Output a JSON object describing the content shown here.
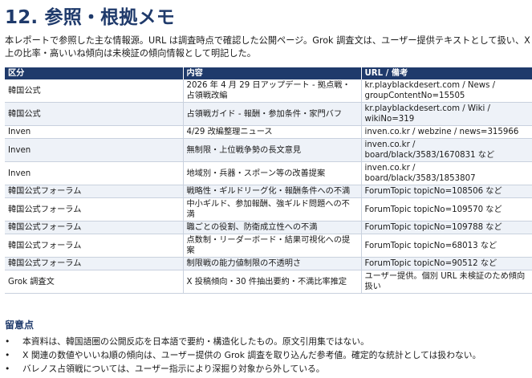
{
  "title": "12. 参照・根拠メモ",
  "intro": {
    "line1": "本レポートで参照した主な情報源。URL は調査時点で確認した公開ページ。Grok 調査文は、ユーザー提供テキストとして扱い、X",
    "line2": "上の比率・高いいね傾向は未検証の傾向情報として明記した。"
  },
  "table": {
    "headers": [
      "区分",
      "内容",
      "URL / 備考"
    ],
    "rows": [
      {
        "category": "韓国公式",
        "content": "2026 年 4 月 29 日アップデート - 拠点戦・占領戦改編",
        "url": "kr.playblackdesert.com / News / groupContentNo=15505"
      },
      {
        "category": "韓国公式",
        "content": "占領戦ガイド - 報酬・参加条件・家門バフ",
        "url": "kr.playblackdesert.com / Wiki / wikiNo=319"
      },
      {
        "category": "Inven",
        "content": "4/29 改編整理ニュース",
        "url": "inven.co.kr / webzine / news=315966"
      },
      {
        "category": "Inven",
        "content": "無制限・上位戦争勢の長文意見",
        "url": "inven.co.kr / board/black/3583/1670831 など"
      },
      {
        "category": "Inven",
        "content": "地域別・兵器・スポーン等の改善提案",
        "url": "inven.co.kr / board/black/3583/1853807"
      },
      {
        "category": "韓国公式フォーラム",
        "content": "戦略性・ギルドリーグ化・報酬条件への不満",
        "url": "ForumTopic topicNo=108506 など"
      },
      {
        "category": "韓国公式フォーラム",
        "content": "中小ギルド、参加報酬、強ギルド問題への不満",
        "url": "ForumTopic topicNo=109570 など"
      },
      {
        "category": "韓国公式フォーラム",
        "content": "職ごとの役割、防衛成立性への不満",
        "url": "ForumTopic topicNo=109788 など"
      },
      {
        "category": "韓国公式フォーラム",
        "content": "点数制・リーダーボード・結果可視化への提案",
        "url": "ForumTopic topicNo=68013 など"
      },
      {
        "category": "韓国公式フォーラム",
        "content": "制限戦の能力値制限の不透明さ",
        "url": "ForumTopic topicNo=90512 など"
      },
      {
        "category": "Grok 調査文",
        "content": "X 投稿傾向・30 件抽出要約・不満比率推定",
        "url": "ユーザー提供。個別 URL 未検証のため傾向扱い"
      }
    ]
  },
  "notes": {
    "title": "留意点",
    "items": [
      "本資料は、韓国語圏の公開反応を日本語で要約・構造化したもの。原文引用集ではない。",
      "X 関連の数値やいいね順の傾向は、ユーザー提供の Grok 調査を取り込んだ参考値。確定的な統計としては扱わない。",
      "バレノス占領戦については、ユーザー指示により深掘り対象から外している。"
    ]
  }
}
